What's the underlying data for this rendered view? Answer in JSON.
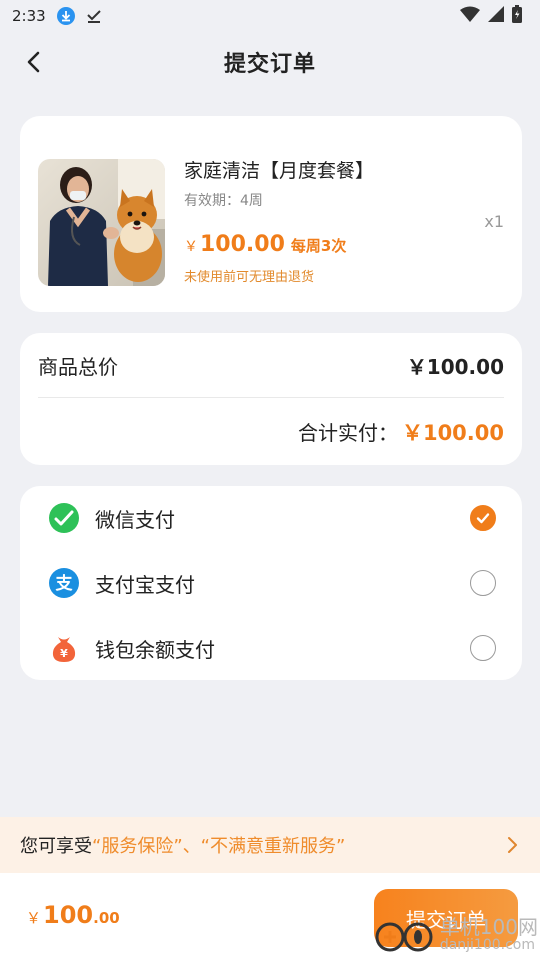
{
  "status_bar": {
    "time": "2:33"
  },
  "header": {
    "title": "提交订单"
  },
  "product": {
    "name": "家庭清洁【月度套餐】",
    "validity": "有效期：4周",
    "quantity": "x1",
    "price_symbol": "￥",
    "price_value": "100.00",
    "frequency": "每周3次",
    "refund_note": "未使用前可无理由退货"
  },
  "totals": {
    "goods_total_label": "商品总价",
    "goods_total_value": "￥100.00",
    "actual_pay_label": "合计实付：",
    "actual_pay_value": "￥100.00"
  },
  "payment": {
    "methods": [
      {
        "label": "微信支付",
        "icon": "wechat-pay-icon",
        "selected": true
      },
      {
        "label": "支付宝支付",
        "icon": "alipay-icon",
        "selected": false
      },
      {
        "label": "钱包余额支付",
        "icon": "wallet-icon",
        "selected": false
      }
    ]
  },
  "insurance": {
    "prefix": "您可享受",
    "highlight": "“服务保险”、“不满意重新服务”"
  },
  "bottom": {
    "symbol": "￥",
    "integer": "100",
    "decimal": ".00",
    "submit_label": "提交订单"
  },
  "watermark": {
    "text_cn": "单机100网",
    "text_en": "danji100.com"
  },
  "colors": {
    "accent": "#f07d1a",
    "background": "#eff0f4",
    "wechat": "#2ec158",
    "alipay": "#1a8fe0",
    "wallet": "#f2643a"
  }
}
